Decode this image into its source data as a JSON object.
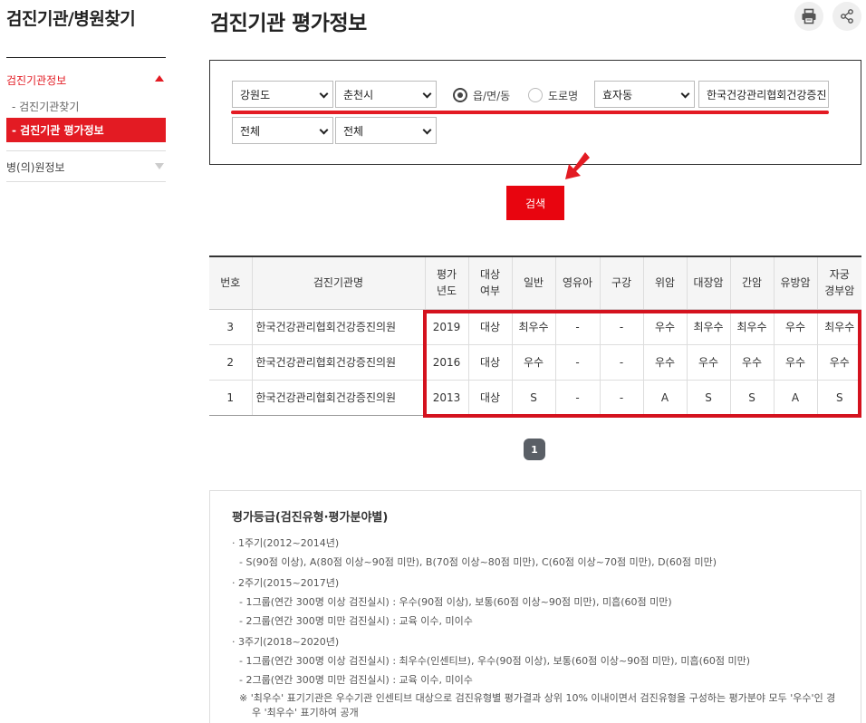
{
  "sidebar": {
    "title": "검진기관/병원찾기",
    "menu1": "검진기관정보",
    "sub1": "-  검진기관찾기",
    "sub2": "-  검진기관 평가정보",
    "menu2": "병(의)원정보"
  },
  "header": {
    "title": "검진기관 평가정보"
  },
  "filters": {
    "province": "강원도",
    "city": "춘천시",
    "radio_option1": "읍/면/동",
    "radio_option2": "도로명",
    "dong": "효자동",
    "institution": "한국건강관리협회건강증진",
    "filter1": "전체",
    "filter2": "전체"
  },
  "search_label": "검색",
  "table": {
    "headers": [
      "번호",
      "검진기관명",
      "평가\n년도",
      "대상\n여부",
      "일반",
      "영유아",
      "구강",
      "위암",
      "대장암",
      "간암",
      "유방암",
      "자궁\n경부암"
    ],
    "rows": [
      [
        "3",
        "한국건강관리협회건강증진의원",
        "2019",
        "대상",
        "최우수",
        "-",
        "-",
        "우수",
        "최우수",
        "최우수",
        "우수",
        "최우수"
      ],
      [
        "2",
        "한국건강관리협회건강증진의원",
        "2016",
        "대상",
        "우수",
        "-",
        "-",
        "우수",
        "우수",
        "우수",
        "우수",
        "우수"
      ],
      [
        "1",
        "한국건강관리협회건강증진의원",
        "2013",
        "대상",
        "S",
        "-",
        "-",
        "A",
        "S",
        "S",
        "A",
        "S"
      ]
    ]
  },
  "pager": {
    "current": "1"
  },
  "info": {
    "title": "평가등급(검진유형·평가분야별)",
    "c1": "·  1주기(2012~2014년)",
    "c1_a": "-  S(90점 이상), A(80점 이상~90점 미만), B(70점 이상~80점 미만), C(60점 이상~70점 미만), D(60점 미만)",
    "c2": "·  2주기(2015~2017년)",
    "c2_a": "-  1그룹(연간 300명 이상 검진실시) : 우수(90점 이상), 보통(60점 이상~90점 미만), 미흡(60점 미만)",
    "c2_b": "-  2그룹(연간 300명 미만 검진실시) : 교육 이수, 미이수",
    "c3": "·  3주기(2018~2020년)",
    "c3_a": "-  1그룹(연간 300명 이상 검진실시) : 최우수(인센티브), 우수(90점 이상), 보통(60점 이상~90점 미만), 미흡(60점 미만)",
    "c3_b": "-  2그룹(연간 300명 미만 검진실시) : 교육 이수, 미이수",
    "note": "※ '최우수' 표기기관은 우수기관 인센티브 대상으로 검진유형별 평가결과 상위 10% 이내이면서 검진유형을 구성하는 평가분야 모두 '우수'인 경우 '최우수' 표기하여 공개"
  },
  "colors": {
    "accent": "#e31b23",
    "pager": "#5a5f66"
  }
}
